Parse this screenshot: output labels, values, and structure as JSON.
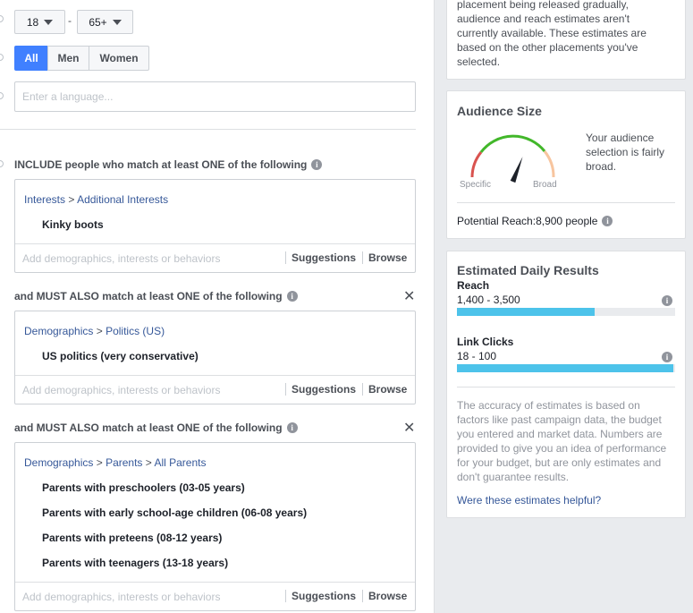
{
  "age": {
    "min": "18",
    "max": "65+",
    "separator": "-"
  },
  "gender": {
    "options": [
      "All",
      "Men",
      "Women"
    ],
    "selected": "All"
  },
  "language": {
    "placeholder": "Enter a language..."
  },
  "targeting": {
    "include_label": "INCLUDE people who match at least ONE of the following",
    "must_label": "and MUST ALSO match at least ONE of the following",
    "footer_placeholder": "Add demographics, interests or behaviors",
    "suggestions": "Suggestions",
    "browse": "Browse",
    "groups": [
      {
        "breadcrumb": [
          "Interests",
          "Additional Interests"
        ],
        "items": [
          "Kinky boots"
        ]
      },
      {
        "breadcrumb": [
          "Demographics",
          "Politics (US)"
        ],
        "items": [
          "US politics (very conservative)"
        ]
      },
      {
        "breadcrumb": [
          "Demographics",
          "Parents",
          "All Parents"
        ],
        "items": [
          "Parents with preschoolers (03-05 years)",
          "Parents with early school-age children (06-08 years)",
          "Parents with preteens (08-12 years)",
          "Parents with teenagers (13-18 years)"
        ]
      }
    ]
  },
  "placement_note": {
    "line1": "placement being released gradually,",
    "line2": "audience and reach estimates aren't",
    "line3": "currently available. These estimates are",
    "line4": "based on the other placements you've",
    "line5": "selected."
  },
  "audience_size": {
    "title": "Audience Size",
    "gauge_specific": "Specific",
    "gauge_broad": "Broad",
    "gauge_level": 0.62,
    "description_lines": [
      "Your audience",
      "selection is fairly",
      "broad."
    ],
    "potential_reach_label": "Potential Reach:",
    "potential_reach_value": "8,900 people"
  },
  "daily_results": {
    "title": "Estimated Daily Results",
    "reach_label": "Reach",
    "reach_range": "1,400 - 3,500",
    "reach_fill": 0.63,
    "clicks_label": "Link Clicks",
    "clicks_range": "18 - 100",
    "clicks_fill": 0.99,
    "disclaimer_lines": [
      "The accuracy of estimates is based on",
      "factors like past campaign data, the budget",
      "you entered and market data. Numbers are",
      "provided to give you an idea of performance",
      "for your budget, but are only estimates and",
      "don't guarantee results."
    ],
    "feedback_link": "Were these estimates helpful?"
  },
  "colors": {
    "accent_blue": "#4080ff",
    "link_blue": "#365899",
    "bar_cyan": "#4dc3ea",
    "gauge_red": "#d9534f",
    "gauge_green": "#42b72a",
    "gauge_peach": "#f7c59f"
  }
}
